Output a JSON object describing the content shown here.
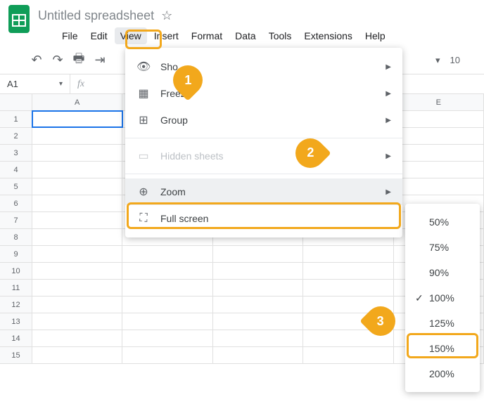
{
  "header": {
    "doc_title": "Untitled spreadsheet",
    "star": "☆"
  },
  "menu": {
    "file": "File",
    "edit": "Edit",
    "view": "View",
    "insert": "Insert",
    "format": "Format",
    "data": "Data",
    "tools": "Tools",
    "extensions": "Extensions",
    "help": "Help"
  },
  "toolbar": {
    "undo": "↶",
    "redo": "↷",
    "print": "🖶",
    "paint": "⇥",
    "dropdown": "▾",
    "fontsize": "10"
  },
  "formula": {
    "cellref": "A1",
    "dd": "▾",
    "fx": "fx"
  },
  "columns": [
    "A",
    "",
    "",
    "",
    "E"
  ],
  "rows": [
    "1",
    "2",
    "3",
    "4",
    "5",
    "6",
    "7",
    "8",
    "9",
    "10",
    "11",
    "12",
    "13",
    "14",
    "15"
  ],
  "view_menu": [
    {
      "icon": "👁",
      "label": "Sho",
      "has_sub": true,
      "disabled": false,
      "hl": false
    },
    {
      "icon": "▦",
      "label": "Freez",
      "has_sub": true,
      "disabled": false,
      "hl": false
    },
    {
      "icon": "⊞",
      "label": "Group",
      "has_sub": true,
      "disabled": false,
      "hl": false
    },
    {
      "sep": true
    },
    {
      "icon": "▭",
      "label": "Hidden sheets",
      "has_sub": true,
      "disabled": true,
      "hl": false
    },
    {
      "sep": true
    },
    {
      "icon": "⊕",
      "label": "Zoom",
      "has_sub": true,
      "disabled": false,
      "hl": true
    },
    {
      "icon": "⛶",
      "label": "Full screen",
      "has_sub": false,
      "disabled": false,
      "hl": false
    }
  ],
  "zoom_menu": [
    {
      "label": "50%",
      "checked": false
    },
    {
      "label": "75%",
      "checked": false
    },
    {
      "label": "90%",
      "checked": false
    },
    {
      "label": "100%",
      "checked": true
    },
    {
      "label": "125%",
      "checked": false
    },
    {
      "label": "150%",
      "checked": false
    },
    {
      "label": "200%",
      "checked": false
    }
  ],
  "annotations": {
    "a1": "1",
    "a2": "2",
    "a3": "3"
  }
}
